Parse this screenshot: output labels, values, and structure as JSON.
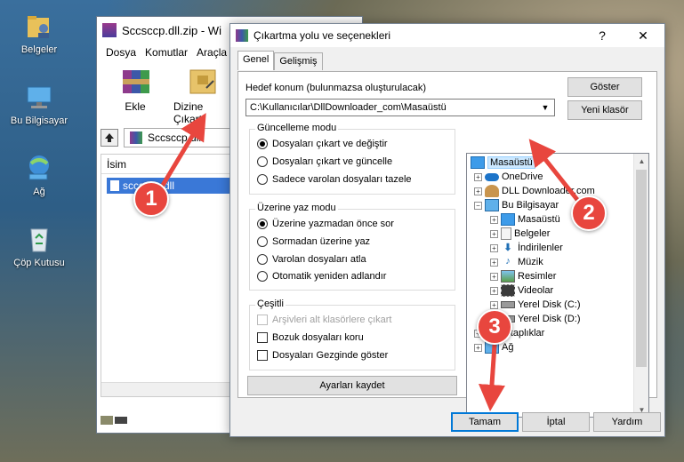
{
  "desktop": {
    "icons": [
      {
        "label": "Belgeler"
      },
      {
        "label": "Bu Bilgisayar"
      },
      {
        "label": "Ağ"
      },
      {
        "label": "Çöp Kutusu"
      }
    ]
  },
  "winrar": {
    "title": "Sccsccp.dll.zip - Wi",
    "menu": [
      "Dosya",
      "Komutlar",
      "Araçla"
    ],
    "toolbar": {
      "add": "Ekle",
      "extract": "Dizine Çıkart"
    },
    "path": "Sccsccp.dll",
    "column_name": "İsim",
    "file": "sccsccp.dll"
  },
  "dialog": {
    "title": "Çıkartma yolu ve seçenekleri",
    "title_help": "?",
    "title_close": "✕",
    "tabs": [
      "Genel",
      "Gelişmiş"
    ],
    "dest_label": "Hedef konum (bulunmazsa oluşturulacak)",
    "dest_value": "C:\\Kullanıcılar\\DllDownloader_com\\Masaüstü",
    "show_button": "Göster",
    "new_folder_button": "Yeni klasör",
    "update_group": {
      "title": "Güncelleme modu",
      "options": [
        "Dosyaları çıkart ve değiştir",
        "Dosyaları çıkart ve güncelle",
        "Sadece varolan dosyaları tazele"
      ],
      "selected": 0
    },
    "overwrite_group": {
      "title": "Üzerine yaz modu",
      "options": [
        "Üzerine yazmadan önce sor",
        "Sormadan üzerine yaz",
        "Varolan dosyaları atla",
        "Otomatik yeniden adlandır"
      ],
      "selected": 0
    },
    "misc_group": {
      "title": "Çeşitli",
      "options": [
        "Arşivleri alt klasörlere çıkart",
        "Bozuk dosyaları koru",
        "Dosyaları Gezginde göster"
      ]
    },
    "save_settings": "Ayarları kaydet",
    "tree": [
      {
        "label": "Masaüstü",
        "icon": "desktop-icon"
      },
      {
        "label": "OneDrive",
        "icon": "cloud-icon"
      },
      {
        "label": "DLL Downloader.com",
        "icon": "user-icon"
      },
      {
        "label": "Bu Bilgisayar",
        "icon": "computer-icon"
      },
      {
        "label": "Masaüstü",
        "icon": "desktop-icon"
      },
      {
        "label": "Belgeler",
        "icon": "document-icon"
      },
      {
        "label": "İndirilenler",
        "icon": "download-icon"
      },
      {
        "label": "Müzik",
        "icon": "music-icon"
      },
      {
        "label": "Resimler",
        "icon": "picture-icon"
      },
      {
        "label": "Videolar",
        "icon": "video-icon"
      },
      {
        "label": "Yerel Disk (C:)",
        "icon": "drive-icon"
      },
      {
        "label": "Yerel Disk (D:)",
        "icon": "drive-icon"
      },
      {
        "label": "Kitaplıklar",
        "icon": "folder-icon"
      },
      {
        "label": "Ağ",
        "icon": "network-icon"
      }
    ],
    "ok": "Tamam",
    "cancel": "İptal",
    "help": "Yardım"
  },
  "annotations": {
    "step1": "1",
    "step2": "2",
    "step3": "3",
    "color": "#e8463e"
  }
}
